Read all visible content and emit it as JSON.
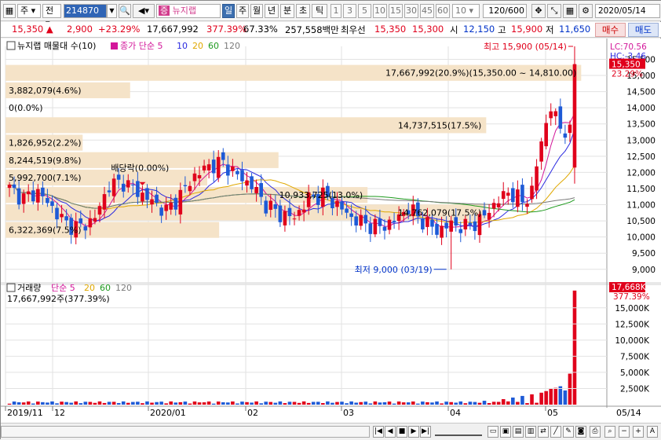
{
  "toolbar": {
    "market": "주",
    "prev": "전",
    "code": "214870",
    "name": "뉴지랩",
    "periods": [
      "일",
      "주",
      "월",
      "년",
      "분",
      "초",
      "틱"
    ],
    "intervals": [
      "1",
      "3",
      "5",
      "10",
      "15",
      "30",
      "45",
      "60"
    ],
    "interval_input": "10",
    "count": "120/600",
    "date": "2020/05/14"
  },
  "quote": {
    "price": "15,350",
    "change": "2,900",
    "change_pct": "+23.29%",
    "volume": "17,667,992",
    "vol_ratio": "377.39%",
    "turnover_pct": "67.33%",
    "amount": "257,558백만",
    "best_label": "최우선",
    "ask": "15,350",
    "bid": "15,300",
    "open_label": "시",
    "open": "12,150",
    "high_label": "고",
    "high": "15,900",
    "low_label": "저",
    "low": "11,650",
    "buy_label": "매수",
    "sell_label": "매도"
  },
  "chart_data": {
    "type": "candlestick",
    "title": "뉴지랩 매물대 수(10)",
    "ma_legend": {
      "label": "종가 단순",
      "periods": [
        "5",
        "10",
        "20",
        "60",
        "120"
      ],
      "colors": [
        "#d3179a",
        "#2a2ae0",
        "#e0a800",
        "#1e9a1e",
        "#7a7a7a"
      ]
    },
    "price_axis": [
      "15,500",
      "15,000",
      "14,500",
      "14,000",
      "13,500",
      "13,000",
      "12,500",
      "12,000",
      "11,500",
      "11,000",
      "10,500",
      "10,000",
      "9,500",
      "9,000"
    ],
    "ylim": [
      8800,
      15900
    ],
    "lc": "LC:70.56",
    "hc": "HC:-3.46",
    "current_price": "15,350",
    "current_pct": "23.29%",
    "max_label": "최고 15,900 (05/14)",
    "min_label": "최저 9,000 (03/19)",
    "dividend_label": "배당락(0.00%)",
    "volume_profile": [
      {
        "label": "17,667,992(20.9%)(15,350.00 ~ 14,810.00)",
        "low": 14810,
        "high": 15350,
        "len": 0.97
      },
      {
        "label": "3,882,079(4.6%)",
        "low": 14270,
        "high": 14810,
        "len": 0.21
      },
      {
        "label": "0(0.0%)",
        "low": 13730,
        "high": 14270,
        "len": 0.0
      },
      {
        "label": "14,737,515(17.5%)",
        "low": 13190,
        "high": 13730,
        "len": 0.81
      },
      {
        "label": "1,826,952(2.2%)",
        "low": 12650,
        "high": 13190,
        "len": 0.13
      },
      {
        "label": "8,244,519(9.8%)",
        "low": 12110,
        "high": 12650,
        "len": 0.46
      },
      {
        "label": "5,992,700(7.1%)",
        "low": 11570,
        "high": 12110,
        "len": 0.34
      },
      {
        "label": "10,933,725(13.0%)",
        "low": 11030,
        "high": 11570,
        "len": 0.61
      },
      {
        "label": "14,762,079(17.5%)",
        "low": 10490,
        "high": 11030,
        "len": 0.81
      },
      {
        "label": "6,322,369(7.5%)",
        "low": 9950,
        "high": 10490,
        "len": 0.36
      }
    ],
    "candles": [],
    "volume_legend": {
      "label": "거래량",
      "ma_label": "단순",
      "periods": [
        "5",
        "20",
        "60",
        "120"
      ]
    },
    "volume_value": "17,667,992주(377.39%)",
    "volume_axis": [
      "15,000K",
      "12,500K",
      "10,000K",
      "7,500K",
      "5,000K",
      "2,500K"
    ],
    "volume_current": "17,668K",
    "volume_current_pct": "377.39%",
    "vlim": [
      0,
      18500000
    ],
    "x_labels": [
      "2019/11",
      "12",
      "2020/01",
      "02",
      "03",
      "04",
      "05"
    ],
    "x_right": "05/14",
    "colors": {
      "up": "#e0001b",
      "down": "#1e5ad6",
      "profile": "#f5e3c8",
      "grid": "#d8d8d8"
    }
  }
}
